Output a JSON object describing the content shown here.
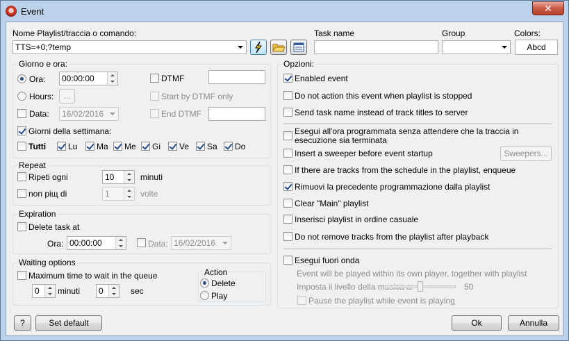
{
  "window": {
    "title": "Event",
    "close_label": "✕"
  },
  "header": {
    "command_label": "Nome Playlist/traccia o comando:",
    "command_value": "TTS=+0;?temp",
    "task_name_label": "Task name",
    "task_name_value": "",
    "group_label": "Group",
    "group_value": "",
    "colors_label": "Colors:",
    "colors_value": "Abcd"
  },
  "schedule": {
    "title": "Giorno e ora:",
    "ora_label": "Ora:",
    "ora_value": "00:00:00",
    "hours_label": "Hours:",
    "hours_button": "...",
    "data_label": "Data:",
    "data_value": "16/02/2016",
    "dtmf_label": "DTMF",
    "dtmf_value": "",
    "start_dtmf_label": "Start by DTMF only",
    "end_dtmf_label": "End DTMF",
    "end_dtmf_value": "",
    "weekdays_label": "Giorni della settimana:",
    "all_label": "Tutti",
    "days": [
      "Lu",
      "Ma",
      "Me",
      "Gi",
      "Ve",
      "Sa",
      "Do"
    ]
  },
  "repeat": {
    "title": "Repeat",
    "repeat_every_label": "Ripeti ogni",
    "repeat_every_value": "10",
    "repeat_unit": "minuti",
    "max_times_label": "non piщ di",
    "max_times_value": "1",
    "max_times_unit": "volte"
  },
  "expiration": {
    "title": "Expiration",
    "delete_label": "Delete task at",
    "ora_label": "Ora:",
    "ora_value": "00:00:00",
    "data_label": "Data:",
    "data_value": "16/02/2016"
  },
  "waiting": {
    "title": "Waiting options",
    "max_wait_label": "Maximum time to wait in the queue",
    "minutes_value": "0",
    "minutes_label": "minuti",
    "seconds_value": "0",
    "seconds_label": "sec",
    "action_title": "Action",
    "delete_label": "Delete",
    "play_label": "Play"
  },
  "options": {
    "title": "Opzioni:",
    "enabled": "Enabled event",
    "no_action_stopped": "Do not action this event when playlist is stopped",
    "send_task_name": "Send task name instead of track titles to server",
    "exact_time": "Esegui all'ora programmata senza attendere che la traccia in esecuzione sia terminata",
    "insert_sweeper": "Insert a sweeper before event startup",
    "sweepers_button": "Sweepers...",
    "enqueue_if_tracks": "If there are tracks from the schedule in the playlist, enqueue",
    "remove_previous": "Rimuovi la precedente programmazione dalla playlist",
    "clear_main": "Clear \"Main\" playlist",
    "random_order": "Inserisci playlist in ordine casuale",
    "keep_tracks": "Do not remove tracks from the playlist after playback",
    "off_air": "Esegui fuori onda",
    "off_air_note": "Event will be played within its own player, together with playlist",
    "volume_label": "Imposta il livello della musica a:",
    "volume_value": "50",
    "volume_level": 0.5,
    "pause_playlist": "Pause the playlist while event is playing"
  },
  "footer": {
    "help_label": "?",
    "set_default_label": "Set default",
    "ok_label": "Ok",
    "cancel_label": "Annulla"
  }
}
